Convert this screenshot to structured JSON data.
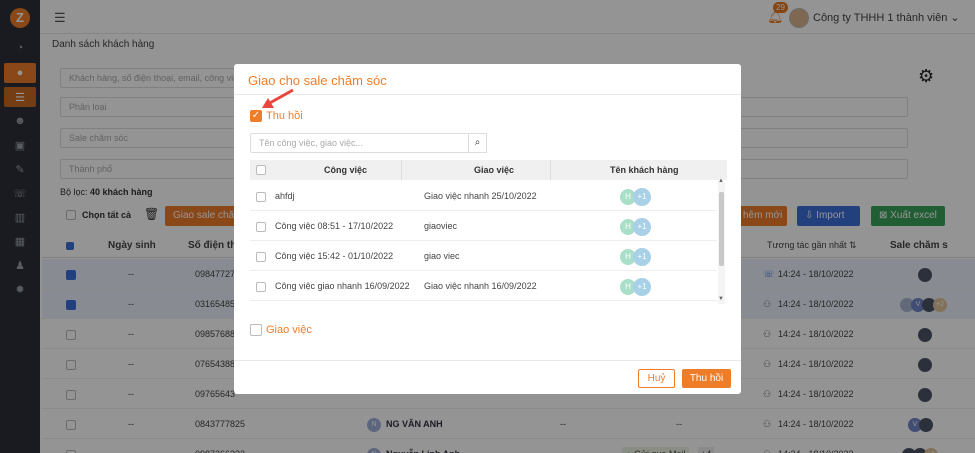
{
  "sidebar": {
    "logo": "Z"
  },
  "topbar": {
    "notif_count": "29",
    "company": "Công ty THHH 1 thành viên"
  },
  "breadcrumb": "Danh sách khách hàng",
  "filters": {
    "search_placeholder": "Khách hàng, số điện thoại, email, công việ",
    "category": "Phân loại",
    "sale": "Sale chăm sóc",
    "city": "Thành phố"
  },
  "filter_result": {
    "label": "Bộ lọc:",
    "count": "40 khách hàng"
  },
  "toolbar": {
    "select_all": "Chọn tất cả",
    "assign_sale": "Giao sale chăm",
    "add_new": "hêm mới",
    "import": "Import",
    "export": "Xuất excel"
  },
  "table": {
    "headers": {
      "dob": "Ngày sinh",
      "phone": "Số điện th",
      "interaction": "Tương tác gần nhất",
      "sale": "Sale chăm s"
    },
    "rows": [
      {
        "checked": true,
        "dob": "--",
        "phone": "09847727",
        "name": "",
        "c1": "",
        "tags": "",
        "time": "14:24 - 18/10/2022"
      },
      {
        "checked": true,
        "dob": "--",
        "phone": "03165485",
        "name": "",
        "c1": "",
        "tags": "",
        "time": "14:24 - 18/10/2022"
      },
      {
        "checked": false,
        "dob": "--",
        "phone": "09857688",
        "name": "",
        "c1": "",
        "tags": "",
        "time": "14:24 - 18/10/2022"
      },
      {
        "checked": false,
        "dob": "--",
        "phone": "07654388",
        "name": "",
        "c1": "",
        "tags": "",
        "time": "14:24 - 18/10/2022"
      },
      {
        "checked": false,
        "dob": "--",
        "phone": "09765643",
        "name": "",
        "c1": "",
        "tags": "",
        "time": "14:24 - 18/10/2022"
      },
      {
        "checked": false,
        "dob": "--",
        "phone": "0843777825",
        "name": "NG VĂN ANH",
        "c1": "--",
        "tags": "--",
        "time": "14:24 - 18/10/2022"
      },
      {
        "checked": false,
        "dob": "--",
        "phone": "0987266233",
        "name": "Nguyễn Linh Anh",
        "c1": "--",
        "tags": "Gửi qua Mail",
        "time": "14:24 - 18/10/2022"
      }
    ],
    "more_tags": "+4",
    "avatar_letter": "N",
    "v_letter": "V",
    "plus2": "+2",
    "plus1": "+1"
  },
  "modal": {
    "title": "Giao cho sale chăm sóc",
    "thu_hoi_label": "Thu hồi",
    "search_placeholder": "Tên công việc, giao việc...",
    "headers": {
      "task": "Công việc",
      "assign": "Giao việc",
      "customer": "Tên khách hàng"
    },
    "rows": [
      {
        "task": "ahfdj",
        "assign": "Giao việc nhanh 25/10/2022",
        "h": "H",
        "plus": "+1"
      },
      {
        "task": "Công việc 08:51 - 17/10/2022",
        "assign": "giaoviec",
        "h": "H",
        "plus": "+1"
      },
      {
        "task": "Công việc 15:42 - 01/10/2022",
        "assign": "giao viec",
        "h": "H",
        "plus": "+1"
      },
      {
        "task": "Công việc giao nhanh 16/09/2022",
        "assign": "Giao việc nhanh 16/09/2022",
        "h": "H",
        "plus": "+1"
      }
    ],
    "giao_viec_label": "Giao việc",
    "cancel": "Huỷ",
    "submit": "Thu hồi"
  },
  "colors": {
    "accent": "#ee7d2a",
    "blue": "#3b6fd8",
    "green": "#3aa35a"
  }
}
